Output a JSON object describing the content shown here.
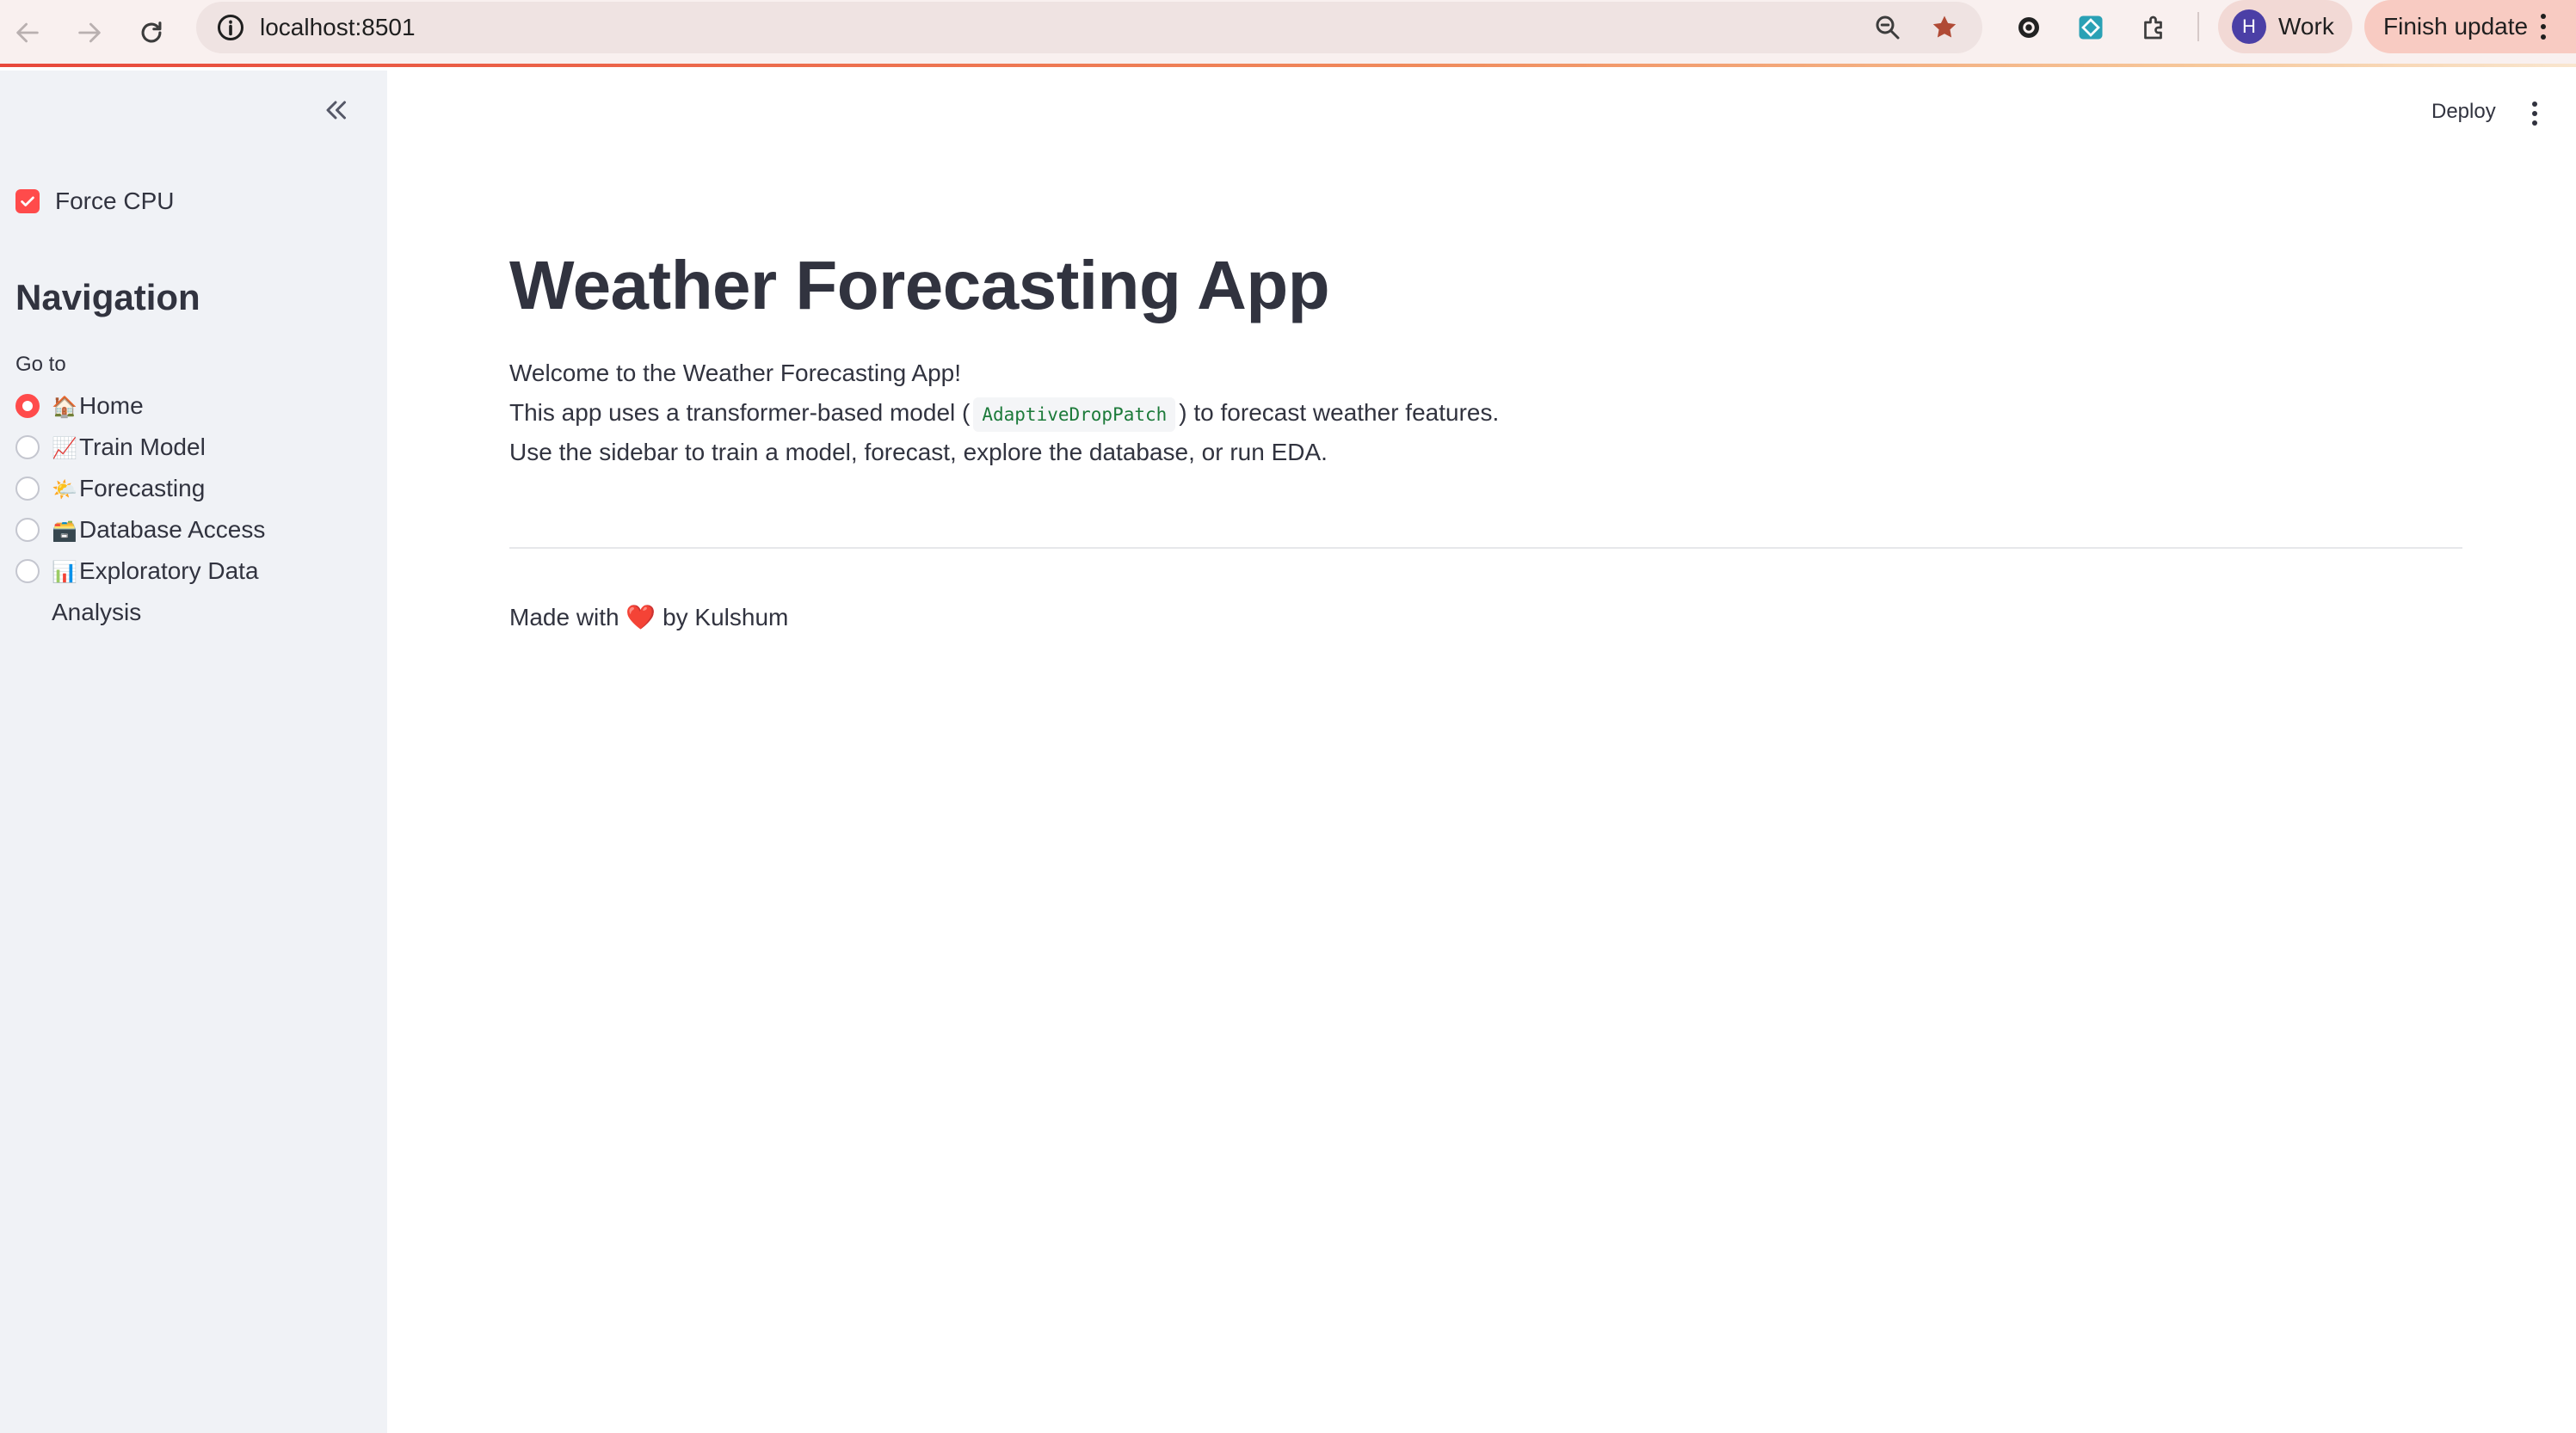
{
  "browser": {
    "url": "localhost:8501",
    "profile_initial": "H",
    "profile_label": "Work",
    "update_label": "Finish update"
  },
  "sidebar": {
    "force_cpu_label": "Force CPU",
    "force_cpu_checked": true,
    "navigation_heading": "Navigation",
    "goto_label": "Go to",
    "items": [
      {
        "emoji": "🏠",
        "label": "Home",
        "selected": true
      },
      {
        "emoji": "📈",
        "label": "Train Model",
        "selected": false
      },
      {
        "emoji": "🌤️",
        "label": "Forecasting",
        "selected": false
      },
      {
        "emoji": "🗃️",
        "label": "Database Access",
        "selected": false
      },
      {
        "emoji": "📊",
        "label": "Exploratory Data Analysis",
        "selected": false
      }
    ]
  },
  "toolbar": {
    "deploy_label": "Deploy"
  },
  "main": {
    "title": "Weather Forecasting App",
    "welcome": "Welcome to the Weather Forecasting App!",
    "desc_prefix": "This app uses a transformer-based model (",
    "model_name": "AdaptiveDropPatch",
    "desc_suffix": ") to forecast weather features.",
    "instructions": "Use the sidebar to train a model, forecast, explore the database, or run EDA.",
    "footer_prefix": "Made with",
    "footer_heart": "❤️",
    "footer_suffix": "by Kulshum"
  },
  "colors": {
    "accent": "#ff4b4b",
    "sidebar_bg": "#f0f2f6",
    "text": "#31333f",
    "code": "#1c7a3a"
  }
}
